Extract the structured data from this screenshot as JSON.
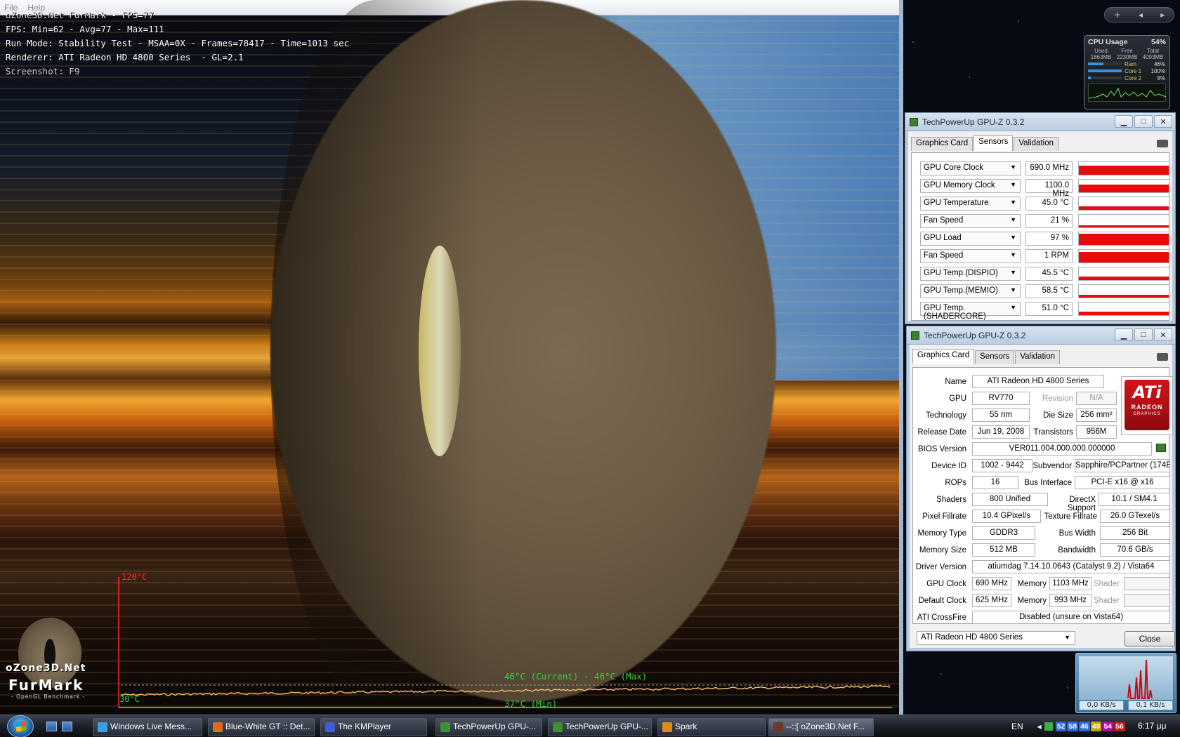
{
  "furmark": {
    "menu": [
      "File",
      "Help"
    ],
    "hud_title": "oZone3D.Net FurMark - FPS=77",
    "hud_fps": "FPS: Min=62 - Avg=77 - Max=111",
    "hud_run": "Run Mode: Stability Test - MSAA=0X - Frames=78417 - Time=1013 sec",
    "hud_renderer": "Renderer: ATI Radeon HD 4800 Series  - GL=2.1",
    "hud_screenshot": "Screenshot: F9",
    "temp_max_label": "120°C",
    "temp_min_label": "30°C",
    "temp_current": "46°C (Current) - 46°C (Max)",
    "temp_min": "37°C (Min)",
    "logo_site": "oZone3D.Net",
    "logo_name": "FurMark",
    "logo_sub": "- OpenGL Benchmark -",
    "temp_series_color": "#f5b26a"
  },
  "cpu_gadget": {
    "title": "CPU Usage",
    "percent": "54%",
    "headers": [
      "Used",
      "Free",
      "Total"
    ],
    "values": [
      "1863MB",
      "2230MB",
      "4093MB"
    ],
    "rows": [
      {
        "label": "Ram",
        "value": "46%",
        "fill": 0.46
      },
      {
        "label": "Core 1",
        "value": "100%",
        "fill": 1.0
      },
      {
        "label": "Core 2",
        "value": "8%",
        "fill": 0.08
      }
    ]
  },
  "gpuz_sensors": {
    "title": "TechPowerUp GPU-Z 0.3.2",
    "tabs": [
      "Graphics Card",
      "Sensors",
      "Validation"
    ],
    "active_tab": "Sensors",
    "rows": [
      {
        "name": "GPU Core Clock",
        "value": "690.0 MHz",
        "level": 0.7
      },
      {
        "name": "GPU Memory Clock",
        "value": "1100.0 MHz",
        "level": 0.6
      },
      {
        "name": "GPU Temperature",
        "value": "45.0 °C",
        "level": 0.3
      },
      {
        "name": "Fan Speed",
        "value": "21 %",
        "level": 0.15
      },
      {
        "name": "GPU Load",
        "value": "97 %",
        "level": 0.9
      },
      {
        "name": "Fan Speed",
        "value": "1 RPM",
        "level": 0.85
      },
      {
        "name": "GPU Temp.(DISPIO)",
        "value": "45.5 °C",
        "level": 0.3
      },
      {
        "name": "GPU Temp.(MEMIO)",
        "value": "58.5 °C",
        "level": 0.25
      },
      {
        "name": "GPU Temp.(SHADERCORE)",
        "value": "51.0 °C",
        "level": 0.3
      }
    ]
  },
  "gpuz_card": {
    "title": "TechPowerUp GPU-Z 0.3.2",
    "tabs": [
      "Graphics Card",
      "Sensors",
      "Validation"
    ],
    "active_tab": "Graphics Card",
    "logo_text": "ATi",
    "logo_radeon": "RADEON",
    "logo_graphics": "GRAPHICS",
    "labels": {
      "name": "Name",
      "gpu": "GPU",
      "revision": "Revision",
      "technology": "Technology",
      "die_size": "Die Size",
      "release_date": "Release Date",
      "transistors": "Transistors",
      "bios_version": "BIOS Version",
      "device_id": "Device ID",
      "subvendor": "Subvendor",
      "rops": "ROPs",
      "bus_interface": "Bus Interface",
      "shaders": "Shaders",
      "directx": "DirectX Support",
      "pixel_fillrate": "Pixel Fillrate",
      "texture_fillrate": "Texture Fillrate",
      "memory_type": "Memory Type",
      "bus_width": "Bus Width",
      "memory_size": "Memory Size",
      "bandwidth": "Bandwidth",
      "driver_version": "Driver Version",
      "gpu_clock": "GPU Clock",
      "memory": "Memory",
      "shader": "Shader",
      "default_clock": "Default Clock",
      "crossfire": "ATI CrossFire"
    },
    "values": {
      "name": "ATI Radeon HD 4800 Series",
      "gpu": "RV770",
      "revision": "N/A",
      "technology": "55 nm",
      "die_size": "256 mm²",
      "release_date": "Jun 19, 2008",
      "transistors": "956M",
      "bios_version": "VER011.004.000.000.000000",
      "device_id": "1002 - 9442",
      "subvendor": "Sapphire/PCPartner (174B)",
      "rops": "16",
      "bus_interface": "PCI-E x16 @ x16",
      "shaders": "800 Unified",
      "directx": "10.1 / SM4.1",
      "pixel_fillrate": "10.4 GPixel/s",
      "texture_fillrate": "26.0 GTexel/s",
      "memory_type": "GDDR3",
      "bus_width": "256 Bit",
      "memory_size": "512 MB",
      "bandwidth": "70.6 GB/s",
      "driver_version": "atiumdag 7.14.10.0643 (Catalyst 9.2) / Vista64",
      "gpu_clock": "690 MHz",
      "gpu_memory": "1103 MHz",
      "default_clock": "625 MHz",
      "default_memory": "993 MHz",
      "crossfire": "Disabled (unsure on Vista64)"
    },
    "select_value": "ATI Radeon HD 4800 Series",
    "close_label": "Close"
  },
  "net_gadget": {
    "down": "0,0 KB/s",
    "up": "0,1 KB/s"
  },
  "taskbar": {
    "buttons": [
      {
        "label": "Windows Live Mess...",
        "color": "#3aa0e0"
      },
      {
        "label": "Blue-White GT :: Det...",
        "color": "#e06a1f"
      },
      {
        "label": "The KMPlayer",
        "color": "#3f5fd0"
      },
      {
        "label": "TechPowerUp GPU-...",
        "color": "#3d8f2f"
      },
      {
        "label": "TechPowerUp GPU-...",
        "color": "#3d8f2f"
      },
      {
        "label": "Spark",
        "color": "#e08a1a"
      },
      {
        "label": "--::[ oZone3D.Net F...",
        "color": "#6a3a2a"
      }
    ],
    "lang": "EN",
    "tray_nums": [
      {
        "text": "52",
        "color": "#2a6ae0"
      },
      {
        "text": "58",
        "color": "#2a6ae0"
      },
      {
        "text": "46",
        "color": "#2a6ae0"
      },
      {
        "text": "49",
        "color": "#b8a60a"
      },
      {
        "text": "54",
        "color": "#b00aa0"
      },
      {
        "text": "56",
        "color": "#c01818"
      }
    ],
    "clock": "6:17 μμ"
  }
}
